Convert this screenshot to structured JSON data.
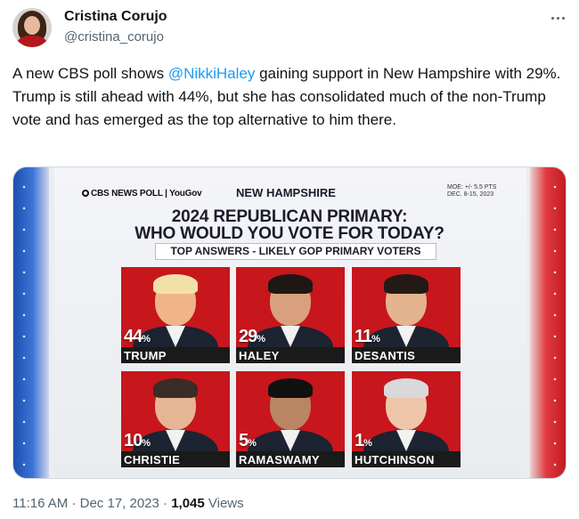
{
  "author": {
    "display_name": "Cristina Corujo",
    "handle": "@cristina_corujo"
  },
  "tweet": {
    "text_before": "A new CBS poll shows ",
    "mention": "@NikkiHaley",
    "text_after": " gaining support in New Hampshire with 29%. Trump is still ahead with 44%, but she has consolidated much of the non-Trump vote and has emerged as the top alternative to him there."
  },
  "graphic": {
    "brand": "CBS NEWS POLL | YouGov",
    "state": "NEW HAMPSHIRE",
    "moe_line1": "MOE: +/- 5.5 PTS",
    "moe_line2": "DEC. 8-15, 2023",
    "headline_line1": "2024 REPUBLICAN PRIMARY:",
    "headline_line2": "WHO WOULD YOU VOTE FOR TODAY?",
    "subheadline": "TOP ANSWERS - LIKELY GOP PRIMARY VOTERS",
    "candidates": [
      {
        "name": "TRUMP",
        "value": "44",
        "unit": "%"
      },
      {
        "name": "HALEY",
        "value": "29",
        "unit": "%"
      },
      {
        "name": "DESANTIS",
        "value": "11",
        "unit": "%"
      },
      {
        "name": "CHRISTIE",
        "value": "10",
        "unit": "%"
      },
      {
        "name": "RAMASWAMY",
        "value": "5",
        "unit": "%"
      },
      {
        "name": "HUTCHINSON",
        "value": "1",
        "unit": "%"
      }
    ]
  },
  "meta": {
    "time": "11:16 AM",
    "separator": " · ",
    "date": "Dec 17, 2023",
    "views_count": "1,045",
    "views_label": " Views"
  },
  "colors": {
    "accent_link": "#1d9bf0",
    "card_red": "#c8161d",
    "text_primary": "#0f1419",
    "text_secondary": "#536471"
  },
  "icons": {
    "more": "more-horizontal-icon"
  }
}
